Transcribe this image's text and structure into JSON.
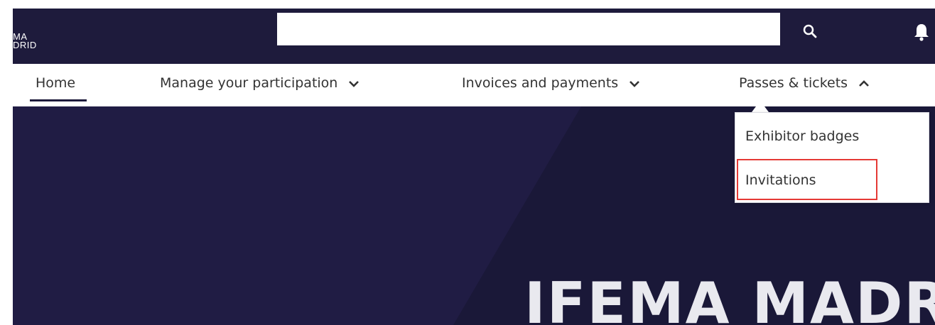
{
  "header": {
    "logo_line1": "MA",
    "logo_line2": "DRID",
    "search": {
      "value": "",
      "placeholder": ""
    },
    "icons": [
      "search-icon",
      "bell-icon"
    ]
  },
  "nav": {
    "items": [
      {
        "label": "Home",
        "active": true
      },
      {
        "label": "Manage your participation",
        "icon": "chevron-down-icon"
      },
      {
        "label": "Invoices and payments",
        "icon": "chevron-down-icon"
      },
      {
        "label": "Passes & tickets",
        "icon": "chevron-up-icon",
        "expanded": true
      }
    ]
  },
  "dropdown": {
    "items": [
      {
        "label": "Exhibitor badges"
      },
      {
        "label": "Invitations",
        "highlighted": true
      }
    ]
  },
  "hero": {
    "title": "IFEMA MADRID"
  },
  "colors": {
    "header_bg": "#1e1b3c",
    "hero_bg": "#201c44",
    "highlight": "#e53935",
    "text": "#333333"
  }
}
